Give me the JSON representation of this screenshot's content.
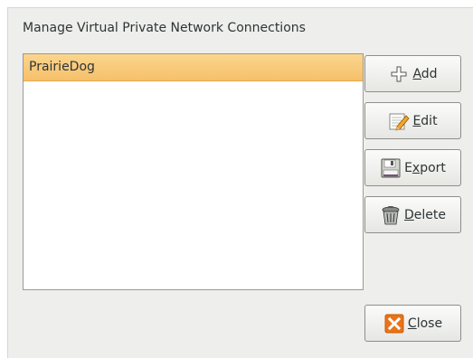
{
  "dialog": {
    "heading": "Manage Virtual Private Network Connections"
  },
  "connections": [
    {
      "name": "PrairieDog",
      "selected": true
    }
  ],
  "buttons": {
    "add": {
      "mnemonic": "A",
      "rest": "dd",
      "icon": "add-icon"
    },
    "edit": {
      "mnemonic": "E",
      "rest": "dit",
      "icon": "edit-icon"
    },
    "export": {
      "pre": "E",
      "mnemonic": "x",
      "rest": "port",
      "icon": "export-icon"
    },
    "delete": {
      "mnemonic": "D",
      "rest": "elete",
      "icon": "trash-icon"
    },
    "close": {
      "mnemonic": "C",
      "rest": "lose",
      "icon": "close-icon"
    }
  },
  "colors": {
    "selection": "#f6c06a",
    "close_icon": "#e8731b"
  }
}
